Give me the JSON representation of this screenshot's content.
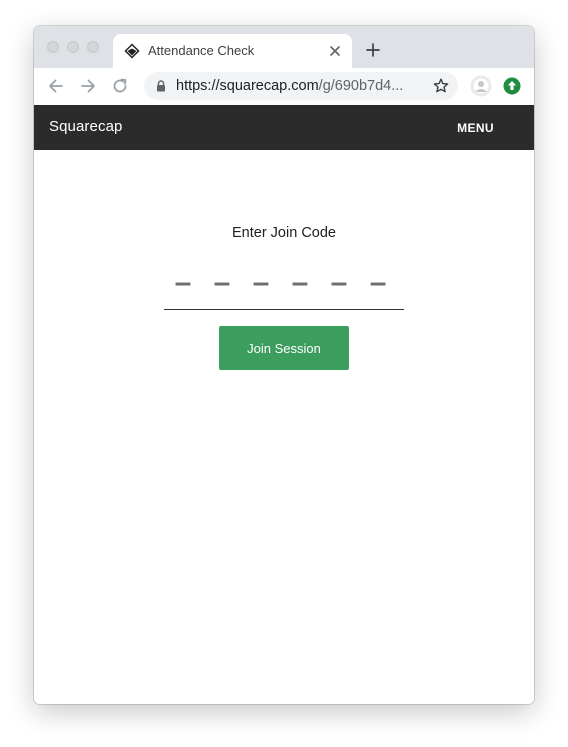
{
  "browser": {
    "tab": {
      "title": "Attendance Check",
      "favicon": "squarecap-logo-icon"
    },
    "url": {
      "host": "https://squarecap.com",
      "path": "/g/690b7d4..."
    },
    "icons": {
      "back": "arrow-left-icon",
      "forward": "arrow-right-icon",
      "reload": "reload-icon",
      "lock": "lock-icon",
      "bookmark": "star-icon",
      "profile": "avatar-icon",
      "extension": "green-upload-icon",
      "close_tab": "close-icon",
      "new_tab": "plus-icon"
    }
  },
  "navbar": {
    "brand": "Squarecap",
    "menu_label": "MENU"
  },
  "join": {
    "label": "Enter Join Code",
    "placeholder": "– – – – – –",
    "value": "",
    "button_label": "Join Session"
  },
  "colors": {
    "navbar_bg": "#2b2b2b",
    "button_green": "#3c9e5e",
    "extension_green": "#1e8e3e"
  }
}
